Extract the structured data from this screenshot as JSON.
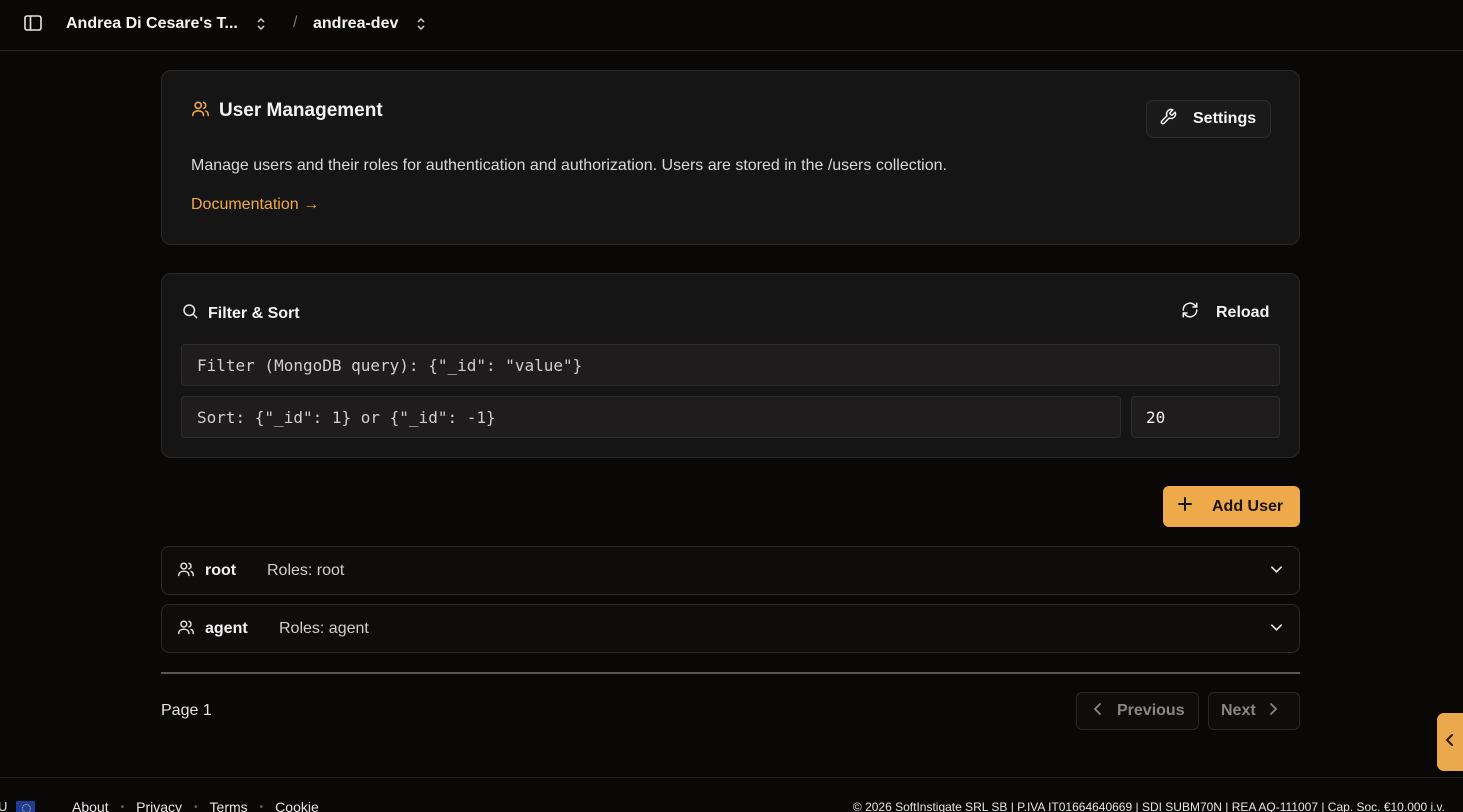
{
  "topbar": {
    "team_name": "Andrea Di Cesare's T...",
    "separator": "/",
    "project_name": "andrea-dev"
  },
  "header": {
    "title": "User Management",
    "description": "Manage users and their roles for authentication and authorization. Users are stored in the /users collection.",
    "doc_link": "Documentation →",
    "settings_label": "Settings"
  },
  "filter": {
    "title": "Filter & Sort",
    "reload_label": "Reload",
    "filter_placeholder": "Filter (MongoDB query): {\"_id\": \"value\"}",
    "sort_placeholder": "Sort: {\"_id\": 1} or {\"_id\": -1}",
    "page_size": "20"
  },
  "actions": {
    "add_user_label": "Add User"
  },
  "users": [
    {
      "name": "root",
      "roles": "Roles: root"
    },
    {
      "name": "agent",
      "roles": "Roles: agent"
    }
  ],
  "pagination": {
    "page_label": "Page 1",
    "previous_label": "Previous",
    "next_label": "Next"
  },
  "footer": {
    "region": "U",
    "links": [
      "About",
      "Privacy",
      "Terms",
      "Cookie"
    ],
    "copyright": "© 2026 SoftInstigate SRL SB | P.IVA IT01664640669 | SDI SUBM70N | REA AQ-111007 | Cap. Soc. €10.000 i.v."
  },
  "colors": {
    "accent": "#eea94b",
    "background": "#0a0707",
    "card": "#161515"
  }
}
